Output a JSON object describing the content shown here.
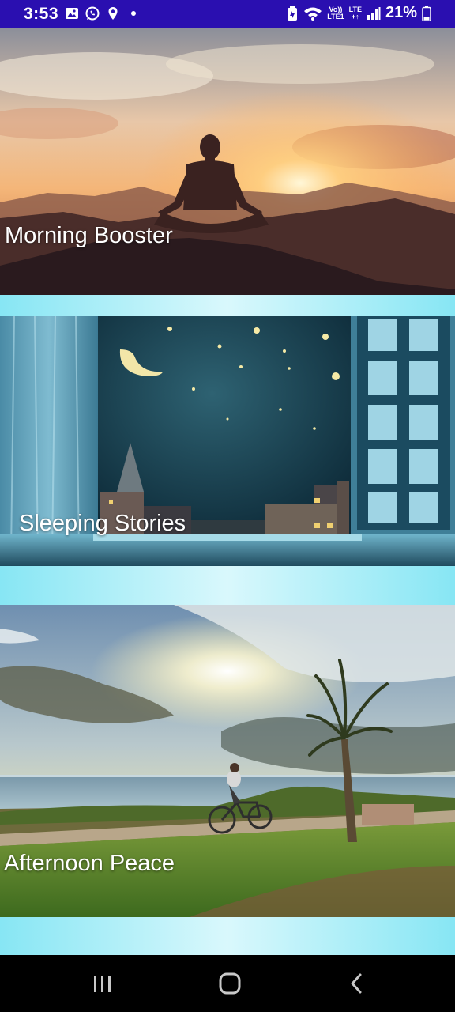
{
  "status_bar": {
    "time": "3:53",
    "network_top": "Vo))",
    "network_bottom": "LTE1",
    "lte_top": "LTE",
    "lte_bottom": "+↑",
    "battery_percent": "21%",
    "icons": [
      "gallery-icon",
      "whatsapp-icon",
      "location-icon",
      "dot-icon",
      "battery-saver-icon",
      "wifi-icon",
      "signal-icon",
      "battery-icon"
    ]
  },
  "cards": [
    {
      "title": "Morning Booster",
      "scene": "meditation-sunrise"
    },
    {
      "title": "Sleeping Stories",
      "scene": "night-window"
    },
    {
      "title": "Afternoon Peace",
      "scene": "beach-bicycle"
    }
  ],
  "nav": {
    "buttons": [
      "recent-apps-button",
      "home-button",
      "back-button"
    ]
  },
  "colors": {
    "status_bar": "#2a0fb0",
    "separator": "#bff0f8",
    "nav_bar": "#000000"
  }
}
